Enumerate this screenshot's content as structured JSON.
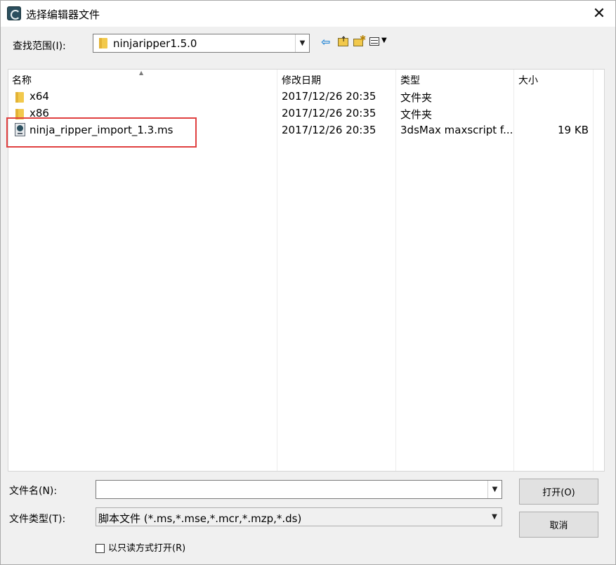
{
  "window": {
    "title": "选择编辑器文件"
  },
  "lookin": {
    "label": "查找范围(I):",
    "value": "ninjaripper1.5.0"
  },
  "toolbar": {
    "icons": [
      "back-arrow-icon",
      "up-folder-icon",
      "new-folder-icon",
      "view-menu-icon"
    ]
  },
  "filelist": {
    "columns": [
      "名称",
      "修改日期",
      "类型",
      "大小"
    ],
    "rows": [
      {
        "icon": "folder-icon",
        "name": "x64",
        "date": "2017/12/26 20:35",
        "type": "文件夹",
        "size": ""
      },
      {
        "icon": "folder-icon",
        "name": "x86",
        "date": "2017/12/26 20:35",
        "type": "文件夹",
        "size": ""
      },
      {
        "icon": "maxscript-file-icon",
        "name": "ninja_ripper_import_1.3.ms",
        "date": "2017/12/26 20:35",
        "type": "3dsMax maxscript f...",
        "size": "19 KB"
      }
    ]
  },
  "filename": {
    "label": "文件名(N):",
    "value": ""
  },
  "filetype": {
    "label": "文件类型(T):",
    "value": "脚本文件 (*.ms,*.mse,*.mcr,*.mzp,*.ds)"
  },
  "buttons": {
    "open": "打开(O)",
    "cancel": "取消"
  },
  "readonly": {
    "label": "以只读方式打开(R)",
    "checked": false
  },
  "colors": {
    "highlight": "#e04040",
    "folder": "#f2c94c"
  }
}
